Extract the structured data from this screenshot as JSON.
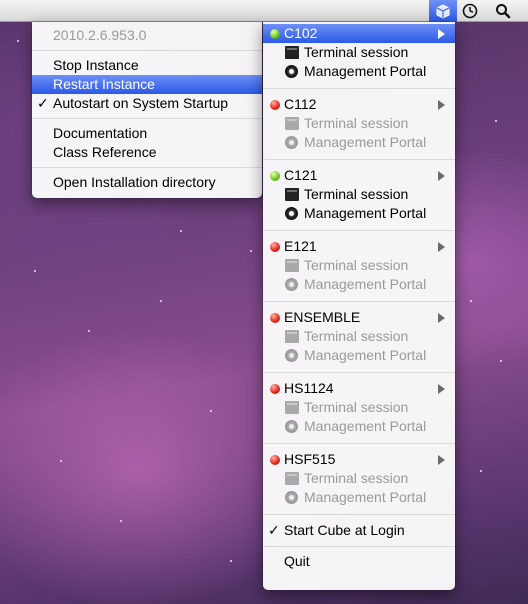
{
  "menubar": {
    "icons": [
      "cube-icon",
      "clock-icon",
      "spotlight-search-icon"
    ]
  },
  "left_menu": {
    "version": "2010.2.6.953.0",
    "stop_instance": "Stop Instance",
    "restart_instance": "Restart Instance",
    "autostart": "Autostart on System Startup",
    "autostart_checkmark": "✓",
    "documentation": "Documentation",
    "class_reference": "Class Reference",
    "open_installation_directory": "Open Installation directory"
  },
  "right_menu": {
    "instances": [
      {
        "name": "C102",
        "status": "green",
        "terminal_session": "Terminal session",
        "management_portal": "Management Portal",
        "enabled": true,
        "highlighted": true
      },
      {
        "name": "C112",
        "status": "red",
        "terminal_session": "Terminal session",
        "management_portal": "Management Portal",
        "enabled": false,
        "highlighted": false
      },
      {
        "name": "C121",
        "status": "green",
        "terminal_session": "Terminal session",
        "management_portal": "Management Portal",
        "enabled": true,
        "highlighted": false
      },
      {
        "name": "E121",
        "status": "red",
        "terminal_session": "Terminal session",
        "management_portal": "Management Portal",
        "enabled": false,
        "highlighted": false
      },
      {
        "name": "ENSEMBLE",
        "status": "red",
        "terminal_session": "Terminal session",
        "management_portal": "Management Portal",
        "enabled": false,
        "highlighted": false
      },
      {
        "name": "HS1124",
        "status": "red",
        "terminal_session": "Terminal session",
        "management_portal": "Management Portal",
        "enabled": false,
        "highlighted": false
      },
      {
        "name": "HSF515",
        "status": "red",
        "terminal_session": "Terminal session",
        "management_portal": "Management Portal",
        "enabled": false,
        "highlighted": false
      }
    ],
    "start_cube_at_login": "Start Cube at Login",
    "start_cube_checkmark": "✓",
    "quit": "Quit"
  },
  "colors": {
    "highlight": "#3d6bef",
    "status_green": "#6ac21a",
    "status_red": "#e0241a",
    "disabled_text": "#9a9a9a"
  }
}
